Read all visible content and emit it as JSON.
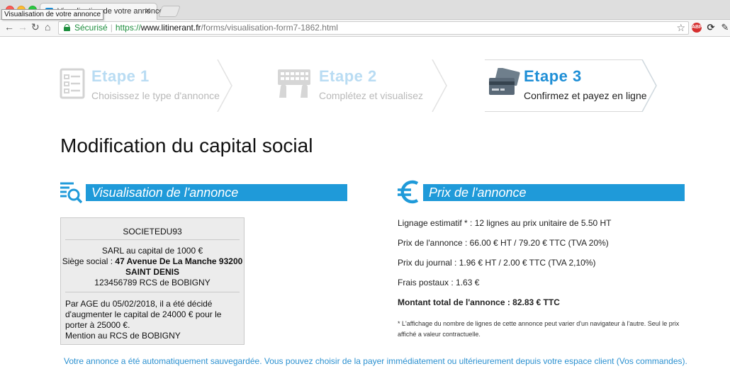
{
  "browser": {
    "tab_title": "Visualisation de votre annonce",
    "tooltip": "Visualisation de votre annonce",
    "secure_label": "Sécurisé",
    "url_scheme": "https://",
    "url_host": "www.litinerant.fr",
    "url_path": "/forms/visualisation-form7-1862.html",
    "ext_abp": "ABP"
  },
  "steps": [
    {
      "title": "Etape 1",
      "subtitle": "Choisissez le type d'annonce",
      "state": "inactive",
      "icon": "checklist-icon"
    },
    {
      "title": "Etape 2",
      "subtitle": "Complétez et visualisez",
      "state": "inactive",
      "icon": "keyboard-icon"
    },
    {
      "title": "Etape 3",
      "subtitle": "Confirmez et payez en ligne",
      "state": "active",
      "icon": "credit-cards-icon"
    }
  ],
  "page_title": "Modification du capital social",
  "preview": {
    "heading": "Visualisation de l'annonce",
    "company": "SOCIETEDU93",
    "capital": "SARL au capital de 1000 €",
    "siege_label": "Siège social : ",
    "siege_address": "47 Avenue De La Manche 93200",
    "city": "SAINT DENIS",
    "rcs": "123456789 RCS de BOBIGNY",
    "body": "Par AGE du 05/02/2018, il a été décidé d'augmenter le capital de 24000 € pour le porter à 25000 €.",
    "mention": "Mention au RCS de BOBIGNY"
  },
  "price": {
    "heading": "Prix de l'annonce",
    "lignage": "Lignage estimatif * : 12 lignes au prix unitaire de 5.50 HT",
    "prix_annonce": "Prix de l'annonce : 66.00 € HT / 79.20 € TTC (TVA 20%)",
    "prix_journal": "Prix du journal : 1.96 € HT / 2.00 € TTC (TVA 2,10%)",
    "frais_postaux": "Frais postaux : 1.63 €",
    "total": "Montant total de l'annonce : 82.83 € TTC",
    "note": "* L'affichage du nombre de lignes de cette annonce peut varier d'un navigateur à l'autre. Seul le prix affiché a valeur contractuelle."
  },
  "footer_message": "Votre annonce a été automatiquement sauvegardée. Vous pouvez choisir de la payer immédiatement ou ultérieurement depuis votre espace client (Vos commandes).",
  "colors": {
    "accent": "#1f9ad9",
    "step_active": "#1f8fd6",
    "step_inactive": "#b9dcf3",
    "footer_link": "#2a90d0"
  }
}
